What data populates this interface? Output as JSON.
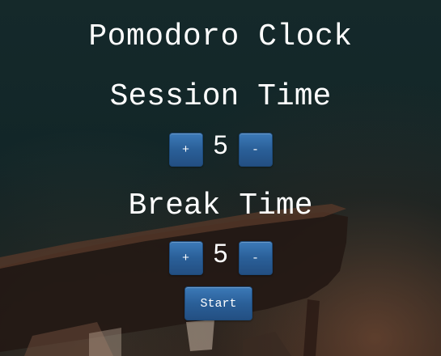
{
  "app": {
    "title": "Pomodoro Clock"
  },
  "session": {
    "heading": "Session Time",
    "increment_label": "+",
    "value": "5",
    "decrement_label": "-"
  },
  "break": {
    "heading": "Break Time",
    "increment_label": "+",
    "value": "5",
    "decrement_label": "-"
  },
  "controls": {
    "start_label": "Start"
  },
  "colors": {
    "button": "#2a5f98",
    "text": "#ffffff",
    "background": "#122628"
  }
}
